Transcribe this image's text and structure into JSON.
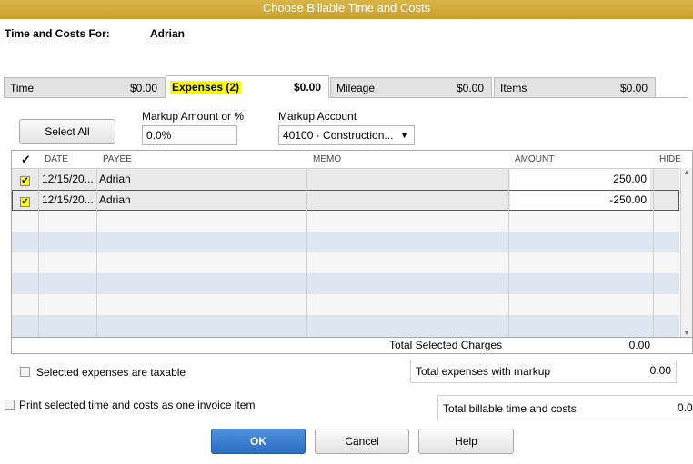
{
  "window": {
    "title": "Choose Billable Time and Costs"
  },
  "header": {
    "label": "Time and Costs For:",
    "customer": "Adrian"
  },
  "tabs": [
    {
      "label": "Time",
      "amount": "$0.00"
    },
    {
      "label": "Expenses (2)",
      "amount": "$0.00"
    },
    {
      "label": "Mileage",
      "amount": "$0.00"
    },
    {
      "label": "Items",
      "amount": "$0.00"
    }
  ],
  "controls": {
    "select_all": "Select All",
    "markup_amount_label": "Markup Amount or %",
    "markup_amount_value": "0.0%",
    "markup_account_label": "Markup Account",
    "markup_account_value": "40100 · Construction..."
  },
  "grid": {
    "columns": {
      "check": "✓",
      "date": "DATE",
      "payee": "PAYEE",
      "memo": "MEMO",
      "amount": "AMOUNT",
      "hide": "HIDE"
    },
    "rows": [
      {
        "checked": true,
        "date": "12/15/20...",
        "payee": "Adrian",
        "memo": "",
        "amount": "250.00"
      },
      {
        "checked": true,
        "date": "12/15/20...",
        "payee": "Adrian",
        "memo": "",
        "amount": "-250.00"
      }
    ],
    "total_label": "Total Selected Charges",
    "total_value": "0.00"
  },
  "taxable_label": "Selected expenses are taxable",
  "total_markup_label": "Total expenses with markup",
  "total_markup_value": "0.00",
  "print_label": "Print selected time and costs as one invoice item",
  "total_billable_label": "Total billable time and costs",
  "total_billable_value": "0.0",
  "buttons": {
    "ok": "OK",
    "cancel": "Cancel",
    "help": "Help"
  },
  "colors": {
    "titlebar": "#d4ab3a",
    "highlight": "#ffff00",
    "row_shade": "#dde6f1",
    "primary_button": "#2a6fc4"
  }
}
